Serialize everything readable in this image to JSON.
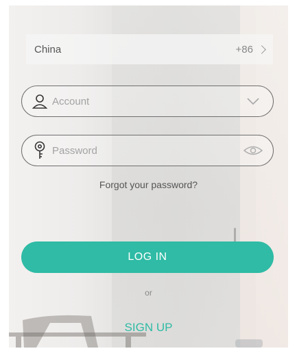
{
  "country": {
    "name": "China",
    "code": "+86"
  },
  "account": {
    "placeholder": "Account",
    "value": ""
  },
  "password": {
    "placeholder": "Password",
    "value": ""
  },
  "forgot_label": "Forgot your password?",
  "login_label": "LOG IN",
  "or_label": "or",
  "signup_label": "SIGN UP",
  "colors": {
    "accent": "#2fbba5",
    "field_border": "#6e6e6e",
    "text": "#555555"
  },
  "icons": {
    "account": "user-icon",
    "account_trailing": "chevron-down-icon",
    "password": "key-icon",
    "password_trailing": "eye-icon",
    "country_trailing": "chevron-right-icon"
  }
}
